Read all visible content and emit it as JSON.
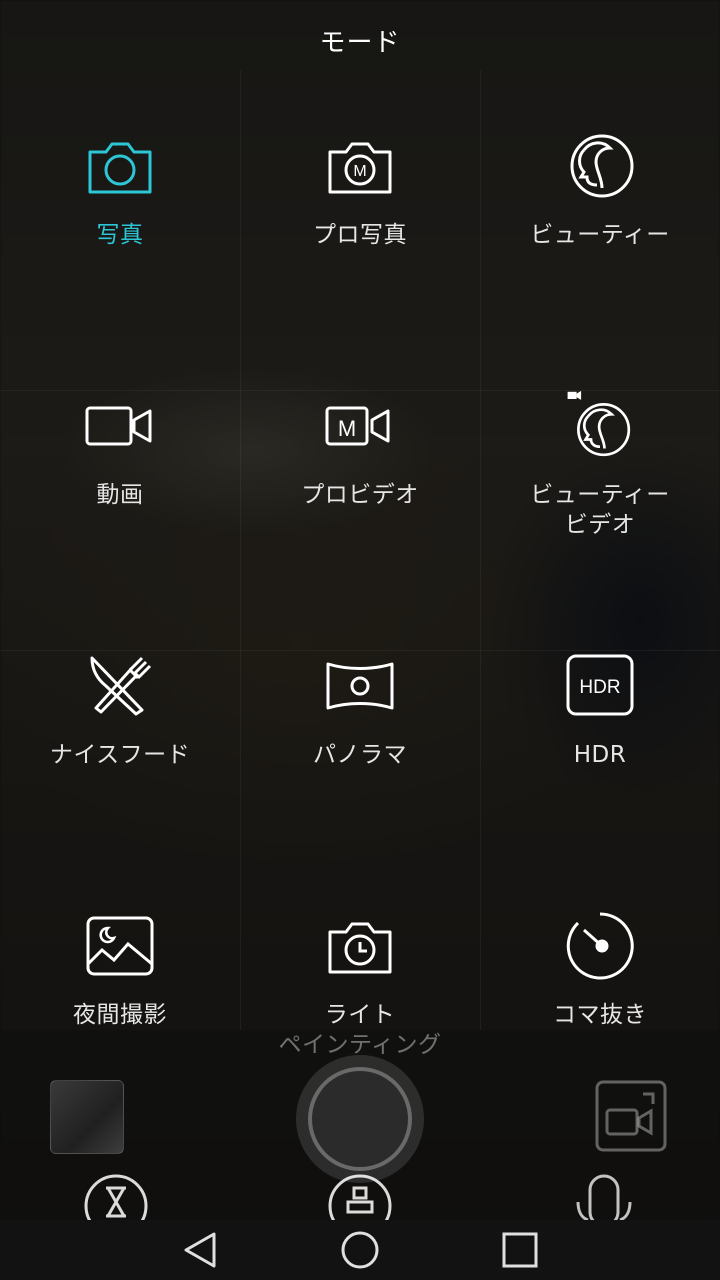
{
  "header": {
    "title": "モード"
  },
  "modes": [
    {
      "id": "photo",
      "label": "写真",
      "icon": "camera-icon",
      "active": true
    },
    {
      "id": "pro-photo",
      "label": "プロ写真",
      "icon": "pro-camera-icon",
      "active": false
    },
    {
      "id": "beauty",
      "label": "ビューティー",
      "icon": "beauty-face-icon",
      "active": false
    },
    {
      "id": "video",
      "label": "動画",
      "icon": "video-camera-icon",
      "active": false
    },
    {
      "id": "pro-video",
      "label": "プロビデオ",
      "icon": "pro-video-icon",
      "active": false
    },
    {
      "id": "beauty-video",
      "label": "ビューティー\nビデオ",
      "icon": "beauty-video-icon",
      "active": false
    },
    {
      "id": "good-food",
      "label": "ナイスフード",
      "icon": "fork-knife-icon",
      "active": false
    },
    {
      "id": "panorama",
      "label": "パノラマ",
      "icon": "panorama-icon",
      "active": false
    },
    {
      "id": "hdr",
      "label": "HDR",
      "icon": "hdr-icon",
      "active": false
    },
    {
      "id": "night",
      "label": "夜間撮影",
      "icon": "night-landscape-icon",
      "active": false
    },
    {
      "id": "light-painting",
      "label": "ライト\nペインティング",
      "icon": "camera-timer-icon",
      "active": false
    },
    {
      "id": "time-lapse",
      "label": "コマ抜き",
      "icon": "time-lapse-dial-icon",
      "active": false
    }
  ],
  "icon_badges": {
    "hdr_text": "HDR",
    "pro_letter": "M"
  },
  "colors": {
    "accent": "#2cc6d6",
    "icon": "#ffffff",
    "text": "#e6e6e6"
  },
  "navigation": {
    "buttons": [
      "back",
      "home",
      "recents"
    ]
  }
}
